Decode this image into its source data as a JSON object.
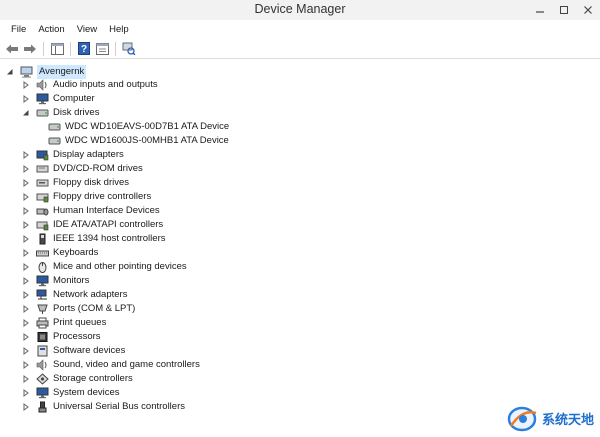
{
  "window": {
    "title": "Device Manager"
  },
  "menu": [
    "File",
    "Action",
    "View",
    "Help"
  ],
  "toolbar": {
    "buttons": [
      {
        "name": "back-button",
        "icon": "back-arrow-icon"
      },
      {
        "name": "forward-button",
        "icon": "forward-arrow-icon"
      },
      {
        "name": "show-hide-console-tree-button",
        "icon": "console-tree-icon"
      },
      {
        "name": "help-button",
        "icon": "help-icon"
      },
      {
        "name": "properties-button",
        "icon": "properties-icon"
      },
      {
        "name": "scan-hardware-button",
        "icon": "scan-hardware-icon"
      }
    ]
  },
  "tree": {
    "root": {
      "label": "Avengernk",
      "icon": "computer-icon"
    },
    "categories": [
      {
        "label": "Audio inputs and outputs",
        "icon": "speaker-icon",
        "expanded": false
      },
      {
        "label": "Computer",
        "icon": "monitor-icon",
        "expanded": false
      },
      {
        "label": "Disk drives",
        "icon": "disk-drive-icon",
        "expanded": true,
        "children": [
          "WDC WD10EAVS-00D7B1 ATA Device",
          "WDC WD1600JS-00MHB1 ATA Device"
        ]
      },
      {
        "label": "Display adapters",
        "icon": "display-adapter-icon",
        "expanded": false
      },
      {
        "label": "DVD/CD-ROM drives",
        "icon": "optical-drive-icon",
        "expanded": false
      },
      {
        "label": "Floppy disk drives",
        "icon": "floppy-drive-icon",
        "expanded": false
      },
      {
        "label": "Floppy drive controllers",
        "icon": "floppy-controller-icon",
        "expanded": false
      },
      {
        "label": "Human Interface Devices",
        "icon": "hid-icon",
        "expanded": false
      },
      {
        "label": "IDE ATA/ATAPI controllers",
        "icon": "ide-controller-icon",
        "expanded": false
      },
      {
        "label": "IEEE 1394 host controllers",
        "icon": "ieee1394-icon",
        "expanded": false
      },
      {
        "label": "Keyboards",
        "icon": "keyboard-icon",
        "expanded": false
      },
      {
        "label": "Mice and other pointing devices",
        "icon": "mouse-icon",
        "expanded": false
      },
      {
        "label": "Monitors",
        "icon": "monitor-icon",
        "expanded": false
      },
      {
        "label": "Network adapters",
        "icon": "network-adapter-icon",
        "expanded": false
      },
      {
        "label": "Ports (COM & LPT)",
        "icon": "port-icon",
        "expanded": false
      },
      {
        "label": "Print queues",
        "icon": "printer-icon",
        "expanded": false
      },
      {
        "label": "Processors",
        "icon": "processor-icon",
        "expanded": false
      },
      {
        "label": "Software devices",
        "icon": "software-device-icon",
        "expanded": false
      },
      {
        "label": "Sound, video and game controllers",
        "icon": "sound-icon",
        "expanded": false
      },
      {
        "label": "Storage controllers",
        "icon": "storage-controller-icon",
        "expanded": false
      },
      {
        "label": "System devices",
        "icon": "system-device-icon",
        "expanded": false
      },
      {
        "label": "Universal Serial Bus controllers",
        "icon": "usb-icon",
        "expanded": false
      }
    ]
  },
  "watermark": {
    "text": "系统天地"
  }
}
